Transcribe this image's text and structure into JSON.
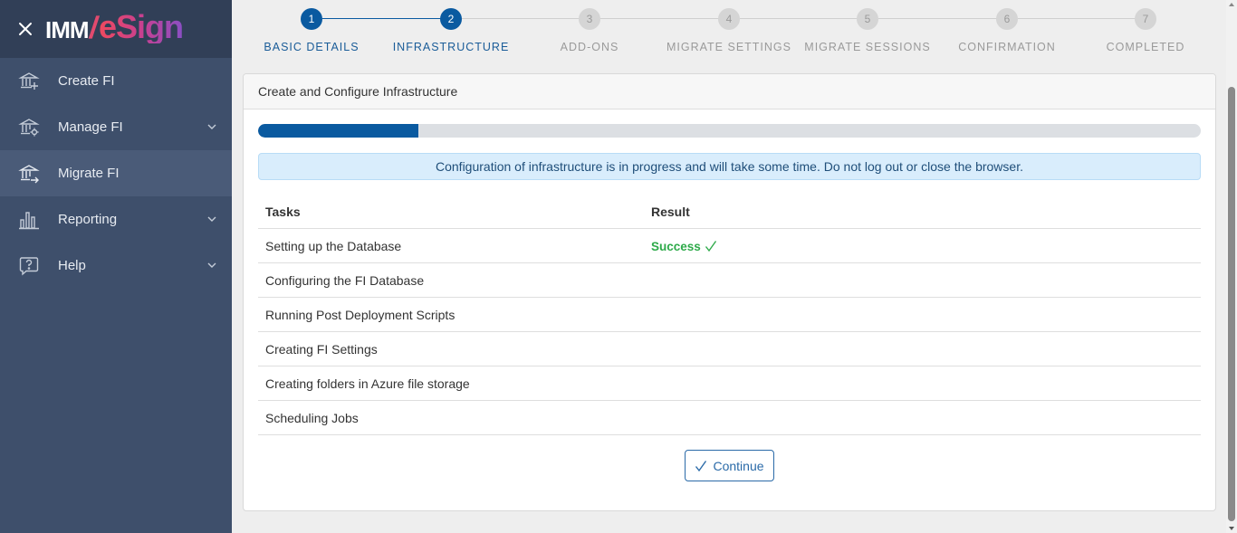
{
  "sidebar": {
    "logo": {
      "imm": "IMM",
      "slash": "/",
      "esign": "eSign"
    },
    "items": [
      {
        "label": "Create FI",
        "icon": "bank-plus-icon",
        "chevron": false,
        "active": false
      },
      {
        "label": "Manage FI",
        "icon": "bank-gear-icon",
        "chevron": true,
        "active": false
      },
      {
        "label": "Migrate FI",
        "icon": "bank-arrow-icon",
        "chevron": false,
        "active": true
      },
      {
        "label": "Reporting",
        "icon": "bar-chart-icon",
        "chevron": true,
        "active": false
      },
      {
        "label": "Help",
        "icon": "help-bubble-icon",
        "chevron": true,
        "active": false
      }
    ]
  },
  "stepper": {
    "steps": [
      {
        "number": "1",
        "label": "BASIC DETAILS",
        "status": "done"
      },
      {
        "number": "2",
        "label": "INFRASTRUCTURE",
        "status": "done"
      },
      {
        "number": "3",
        "label": "ADD-ONS",
        "status": "todo"
      },
      {
        "number": "4",
        "label": "MIGRATE SETTINGS",
        "status": "todo"
      },
      {
        "number": "5",
        "label": "MIGRATE SESSIONS",
        "status": "todo"
      },
      {
        "number": "6",
        "label": "CONFIRMATION",
        "status": "todo"
      },
      {
        "number": "7",
        "label": "COMPLETED",
        "status": "todo"
      }
    ]
  },
  "card": {
    "title": "Create and Configure Infrastructure",
    "progress_percent": 17,
    "alert": "Configuration of infrastructure is in progress and will take some time. Do not log out or close the browser.",
    "table": {
      "headers": {
        "task": "Tasks",
        "result": "Result"
      },
      "rows": [
        {
          "task": "Setting up the Database",
          "result": "Success"
        },
        {
          "task": "Configuring the FI Database",
          "result": ""
        },
        {
          "task": "Running Post Deployment Scripts",
          "result": ""
        },
        {
          "task": "Creating FI Settings",
          "result": ""
        },
        {
          "task": "Creating folders in Azure file storage",
          "result": ""
        },
        {
          "task": "Scheduling Jobs",
          "result": ""
        }
      ]
    },
    "continue_label": "Continue"
  },
  "colors": {
    "sidebar_bg": "#3e4f6b",
    "sidebar_header_bg": "#313f57",
    "primary": "#0a5aa0",
    "success": "#2eaa4a",
    "alert_bg": "#d9edfc"
  }
}
